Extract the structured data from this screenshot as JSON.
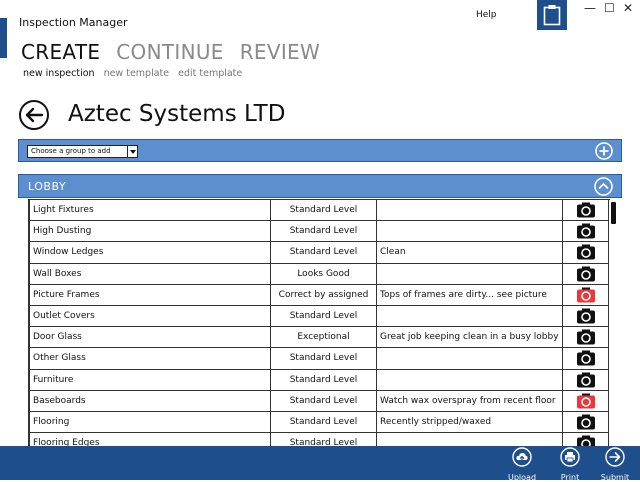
{
  "window": {
    "title": "Inspection Manager",
    "help_label": "Help",
    "minimize_label": "—",
    "maximize_label": "☐",
    "close_label": "✕"
  },
  "nav": {
    "tabs": [
      {
        "label": "CREATE",
        "active": true
      },
      {
        "label": "CONTINUE",
        "active": false
      },
      {
        "label": "REVIEW",
        "active": false
      }
    ],
    "subtabs": [
      {
        "label": "new inspection",
        "active": true
      },
      {
        "label": "new template",
        "active": false
      },
      {
        "label": "edit template",
        "active": false
      }
    ]
  },
  "page": {
    "company": "Aztec Systems LTD"
  },
  "group_select": {
    "value": "Choose a group to add"
  },
  "section": {
    "title": "LOBBY"
  },
  "rows": [
    {
      "name": "Light Fixtures",
      "level": "Standard Level",
      "note": "",
      "photo": false
    },
    {
      "name": "High Dusting",
      "level": "Standard Level",
      "note": "",
      "photo": false
    },
    {
      "name": "Window Ledges",
      "level": "Standard Level",
      "note": "Clean",
      "photo": false
    },
    {
      "name": "Wall Boxes",
      "level": "Looks Good",
      "note": "",
      "photo": false
    },
    {
      "name": "Picture Frames",
      "level": "Correct by assigned",
      "note": "Tops of frames are dirty... see picture",
      "photo": true
    },
    {
      "name": "Outlet Covers",
      "level": "Standard Level",
      "note": "",
      "photo": false
    },
    {
      "name": "Door Glass",
      "level": "Exceptional",
      "note": "Great job keeping clean in a busy lobby",
      "photo": false
    },
    {
      "name": "Other Glass",
      "level": "Standard Level",
      "note": "",
      "photo": false
    },
    {
      "name": "Furniture",
      "level": "Standard Level",
      "note": "",
      "photo": false
    },
    {
      "name": "Baseboards",
      "level": "Standard Level",
      "note": "Watch wax overspray from recent floor",
      "photo": true
    },
    {
      "name": "Flooring",
      "level": "Standard Level",
      "note": "Recently stripped/waxed",
      "photo": false
    },
    {
      "name": "Flooring Edges",
      "level": "Standard Level",
      "note": "",
      "photo": false
    }
  ],
  "footer": {
    "upload_label": "Upload",
    "print_label": "Print",
    "submit_label": "Submit"
  },
  "colors": {
    "brand_dark": "#1f4e8c",
    "bar_blue": "#5d8fcf",
    "camera_black": "#111111",
    "camera_red": "#e8383d"
  }
}
